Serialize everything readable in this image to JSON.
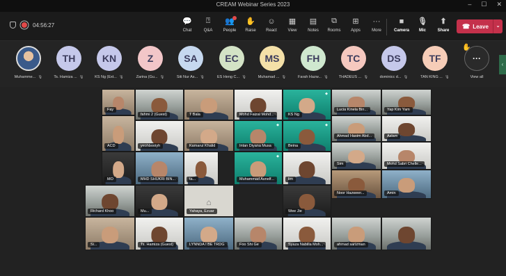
{
  "window": {
    "title": "CREAM Webinar Series 2023"
  },
  "meeting": {
    "timer": "04:56:27"
  },
  "toolbar": {
    "items": [
      {
        "label": "Chat",
        "icon": "chat-icon"
      },
      {
        "label": "Q&A",
        "icon": "qa-icon"
      },
      {
        "label": "People",
        "icon": "people-icon"
      },
      {
        "label": "Raise",
        "icon": "raise-hand-icon"
      },
      {
        "label": "React",
        "icon": "react-icon"
      },
      {
        "label": "View",
        "icon": "view-icon"
      },
      {
        "label": "Notes",
        "icon": "notes-icon"
      },
      {
        "label": "Rooms",
        "icon": "rooms-icon"
      },
      {
        "label": "Apps",
        "icon": "apps-icon"
      },
      {
        "label": "More",
        "icon": "more-icon"
      },
      {
        "label": "Camera",
        "icon": "camera-icon"
      },
      {
        "label": "Mic",
        "icon": "mic-icon"
      },
      {
        "label": "Share",
        "icon": "share-icon"
      }
    ],
    "leave_label": "Leave"
  },
  "strip": {
    "participants": [
      {
        "initials": "",
        "name": "Muhamme...",
        "photo": true,
        "color": ""
      },
      {
        "initials": "TH",
        "name": "Ts. Hamiza ...",
        "color": "#c5c8ea"
      },
      {
        "initials": "KN",
        "name": "KS Ng (Ext...",
        "color": "#c5c8ea"
      },
      {
        "initials": "Z",
        "name": "Zarina (Gu...",
        "color": "#f2c6c8"
      },
      {
        "initials": "SA",
        "name": "Siti Nur As...",
        "color": "#c6d8ef"
      },
      {
        "initials": "EC",
        "name": "ES Heng C...",
        "color": "#d3e3c6"
      },
      {
        "initials": "MS",
        "name": "Muhamad ...",
        "color": "#f4e0a8"
      },
      {
        "initials": "FH",
        "name": "Farah Hazw...",
        "color": "#cfe8cf"
      },
      {
        "initials": "TC",
        "name": "THADEUS ...",
        "color": "#f5c8bf"
      },
      {
        "initials": "DS",
        "name": "dominicc d...",
        "color": "#c5c8ea"
      },
      {
        "initials": "TF",
        "name": "TAN KING ...",
        "color": "#f6cdb8"
      }
    ],
    "view_all_label": "View all"
  },
  "gallery": {
    "tiles": [
      {
        "name": "Fay",
        "style": "warm"
      },
      {
        "name": "fahmi 2 (Guest)",
        "style": "office"
      },
      {
        "name": "T Bala",
        "style": "warm"
      },
      {
        "name": "Mohd Faizal Mohd...",
        "style": "white"
      },
      {
        "name": "KS Ng",
        "style": "green"
      },
      {
        "name": "Lucia Kinela Bin...",
        "style": "office"
      },
      {
        "name": "Yap Kim Yam",
        "style": "office"
      },
      {
        "name": "ACD",
        "style": "warm"
      },
      {
        "name": "yeohbooiyh",
        "style": "white"
      },
      {
        "name": "Kamarul Khalid",
        "style": "warm"
      },
      {
        "name": "Intan Diyana Musa",
        "style": "green"
      },
      {
        "name": "Beina",
        "style": "green"
      },
      {
        "name": "Ahmad Hasim Abd...",
        "style": "office"
      },
      {
        "name": "Aslam",
        "style": "white"
      },
      {
        "name": "MO",
        "style": "dark"
      },
      {
        "name": "MHD SHUKRI BIN...",
        "style": "blue"
      },
      {
        "name": "ta...",
        "style": "white"
      },
      {
        "name": "Muhammad Asnelf...",
        "style": "green"
      },
      {
        "name": "lim",
        "style": "white"
      },
      {
        "name": "Sim",
        "style": "office"
      },
      {
        "name": "Mohd Sabri Chelle...",
        "style": "white"
      },
      {
        "name": "Noor Hazweer...",
        "style": "shelf"
      },
      {
        "name": "Amin",
        "style": "blue"
      },
      {
        "name": "Richard Khoo",
        "style": "office"
      },
      {
        "name": "Mu...",
        "style": "dark"
      },
      {
        "name": "Yahaya, Ezuar",
        "style": "avatar"
      },
      {
        "name": "Wee Jie",
        "style": "dark"
      },
      {
        "name": "Si...",
        "style": "warm"
      },
      {
        "name": "Ts. Hamiza (Guest)",
        "style": "white"
      },
      {
        "name": "LYNNDA I BE TRDG",
        "style": "blue"
      },
      {
        "name": "Foo Shi Ge",
        "style": "office"
      },
      {
        "name": "Syaza Nabilla Moh...",
        "style": "white"
      },
      {
        "name": "ahmad sarizman",
        "style": "office"
      },
      {
        "name": "",
        "style": "office"
      }
    ]
  }
}
